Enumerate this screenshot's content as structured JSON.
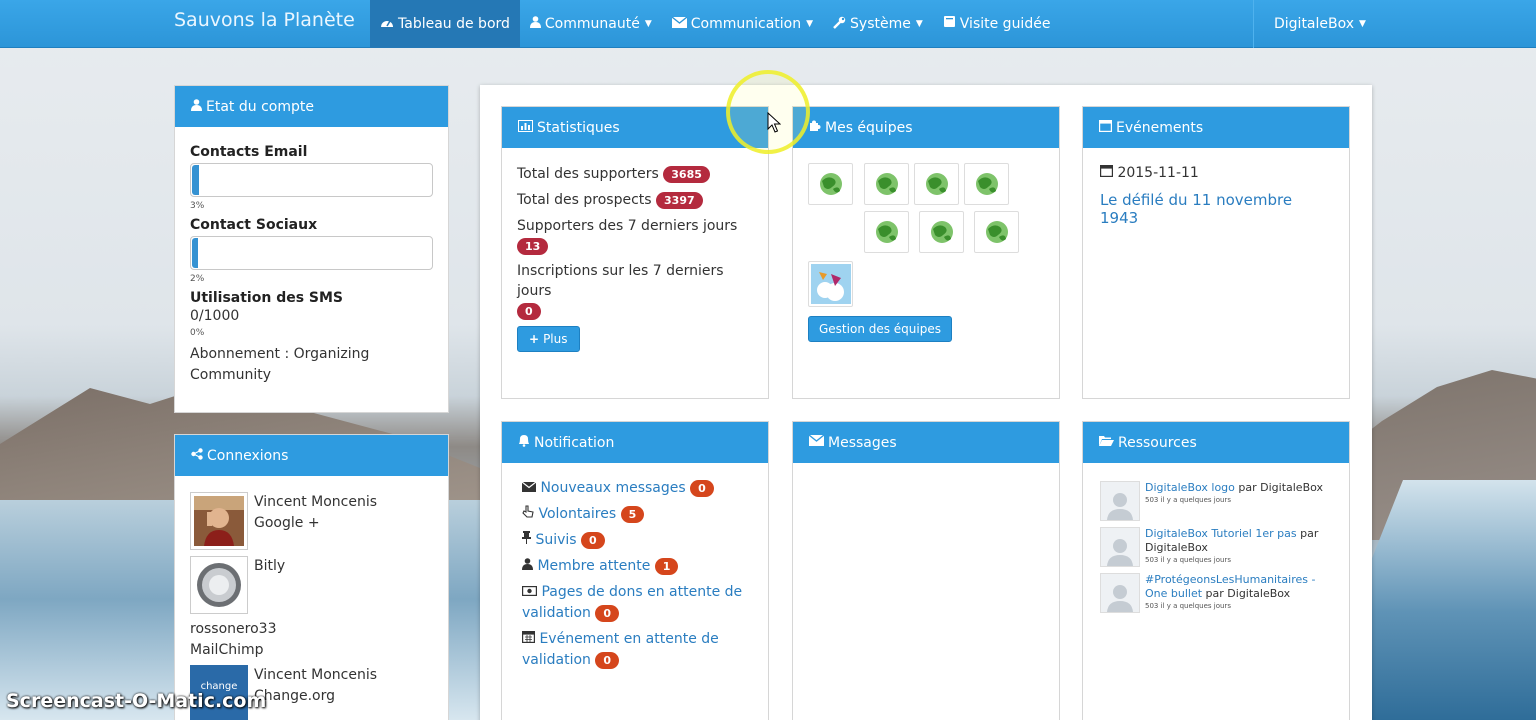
{
  "navbar": {
    "brand": "Sauvons la Planète",
    "items": [
      {
        "label": "Tableau de bord",
        "icon": "dashboard-icon",
        "active": true,
        "caret": false
      },
      {
        "label": "Communauté",
        "icon": "user-icon",
        "active": false,
        "caret": true
      },
      {
        "label": "Communication",
        "icon": "envelope-icon",
        "active": false,
        "caret": true
      },
      {
        "label": "Système",
        "icon": "wrench-icon",
        "active": false,
        "caret": true
      },
      {
        "label": "Visite guidée",
        "icon": "book-icon",
        "active": false,
        "caret": false
      }
    ],
    "user": "DigitaleBox"
  },
  "account": {
    "title": "Etat du compte",
    "email_label": "Contacts Email",
    "email_pct": "3%",
    "email_fill": 0.03,
    "social_label": "Contact Sociaux",
    "social_pct": "2%",
    "social_fill": 0.02,
    "sms_label": "Utilisation des SMS",
    "sms_value": "0/1000",
    "sms_pct": "0%",
    "subscription": "Abonnement : Organizing Community"
  },
  "connections": {
    "title": "Connexions",
    "items": [
      {
        "name": "Vincent Moncenis",
        "service": "Google +"
      },
      {
        "name": "Bitly",
        "service": ""
      },
      {
        "name": "rossonero33",
        "service": "MailChimp"
      },
      {
        "name": "Vincent Moncenis",
        "service": "Change.org"
      }
    ],
    "change_logo_text": "change"
  },
  "stats": {
    "title": "Statistiques",
    "supporters_label": "Total des supporters",
    "supporters_value": "3685",
    "prospects_label": "Total des prospects",
    "prospects_value": "3397",
    "week_supporters_label": "Supporters des 7 derniers jours",
    "week_supporters_value": "13",
    "week_signups_label": "Inscriptions sur les 7 derniers jours",
    "week_signups_value": "0",
    "more_button": "Plus"
  },
  "teams": {
    "title": "Mes équipes",
    "button": "Gestion des équipes"
  },
  "events": {
    "title": "Evénements",
    "date": "2015-11-11",
    "event_title": "Le défilé du 11 novembre 1943"
  },
  "notifications": {
    "title": "Notification",
    "items": [
      {
        "label": "Nouveaux messages",
        "count": "0",
        "icon": "envelope-icon"
      },
      {
        "label": "Volontaires",
        "count": "5",
        "icon": "hand-pointer-icon"
      },
      {
        "label": "Suivis",
        "count": "0",
        "icon": "pin-icon"
      },
      {
        "label": "Membre attente",
        "count": "1",
        "icon": "user-icon"
      },
      {
        "label": "Pages de dons en attente de validation",
        "count": "0",
        "icon": "money-icon"
      },
      {
        "label": "Evénement en attente de validation",
        "count": "0",
        "icon": "calendar-icon"
      }
    ]
  },
  "messages": {
    "title": "Messages"
  },
  "resources": {
    "title": "Ressources",
    "items": [
      {
        "link": "DigitaleBox logo",
        "by": "par DigitaleBox",
        "meta": "503 il y a quelques jours"
      },
      {
        "link": "DigitaleBox Tutoriel 1er pas",
        "by": "par DigitaleBox",
        "meta": "503 il y a quelques jours"
      },
      {
        "link": "#ProtégeonsLesHumanitaires - One bullet",
        "by": "par DigitaleBox",
        "meta": "503 il y a quelques jours"
      }
    ]
  },
  "watermark": "Screencast-O-Matic.com",
  "colors": {
    "primary": "#2e9be0",
    "badge_red": "#b42a3e",
    "badge_orange": "#d5461c",
    "link": "#2a7dc0"
  }
}
